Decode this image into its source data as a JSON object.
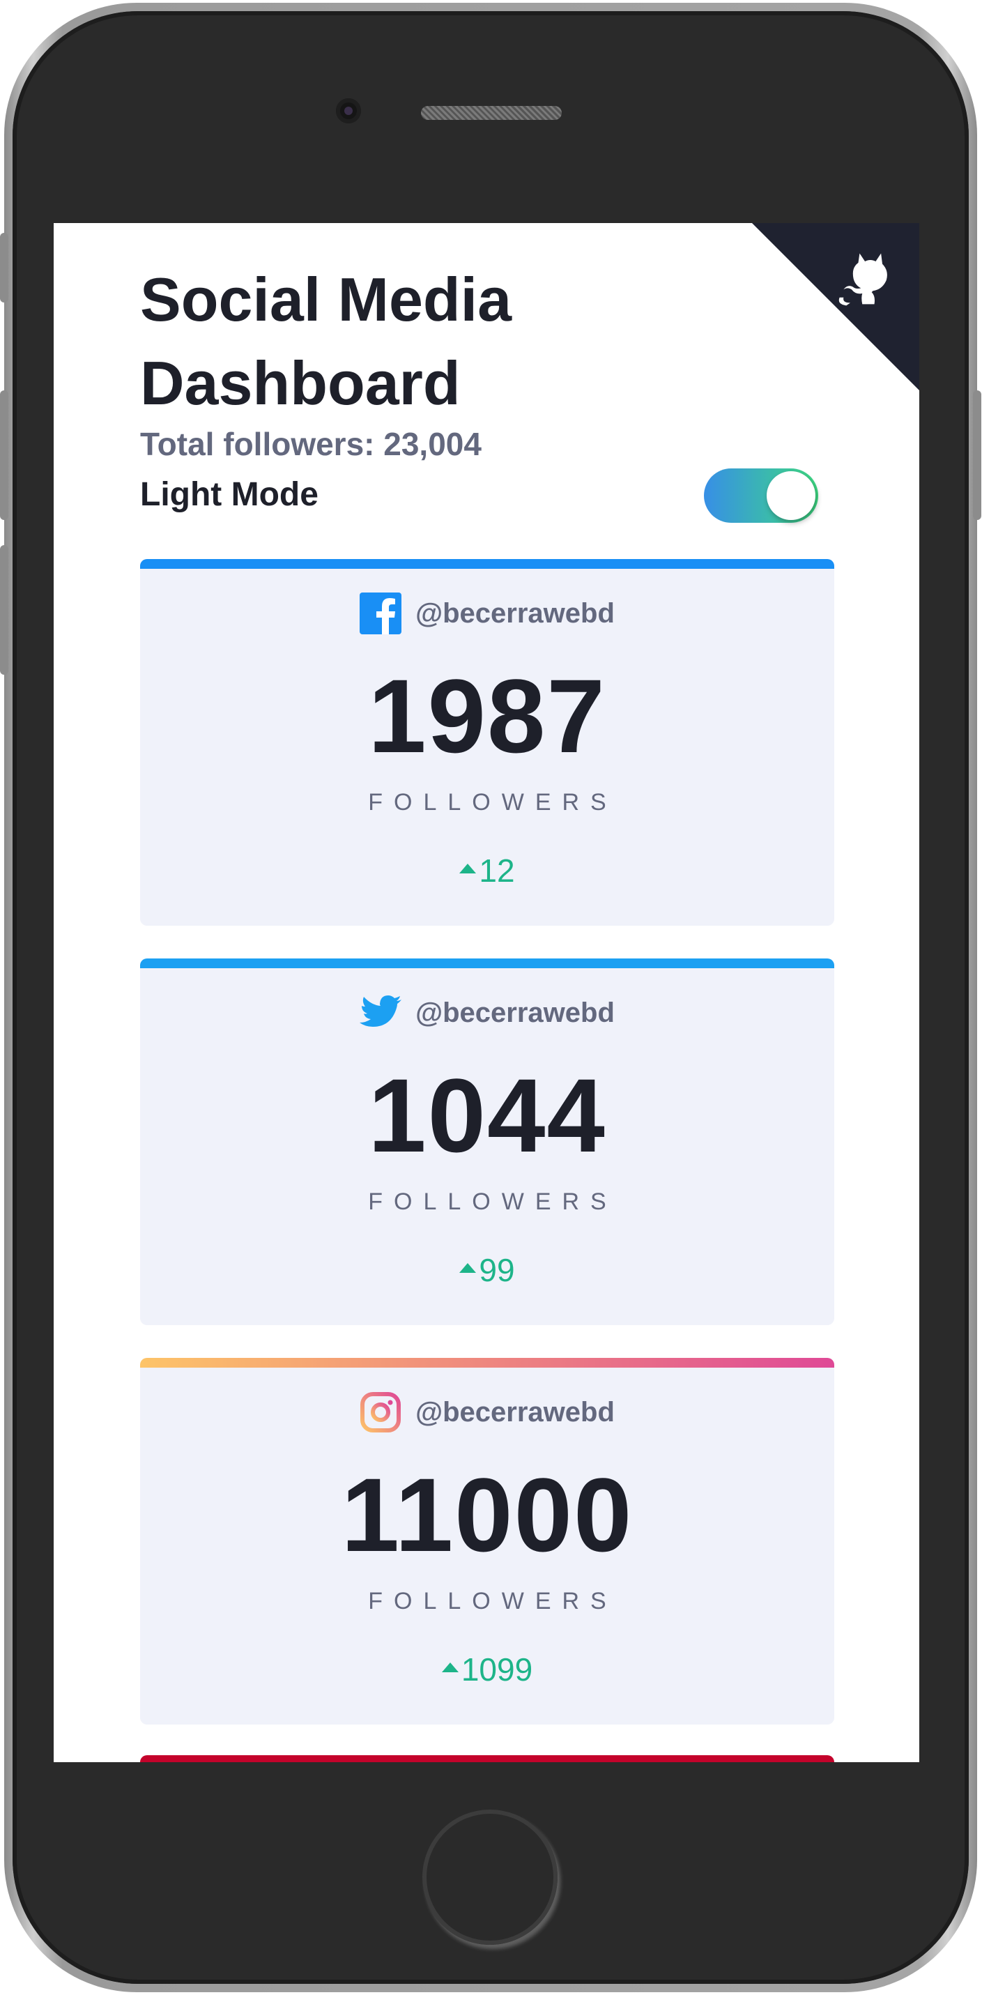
{
  "header": {
    "title": "Social Media Dashboard",
    "total_followers": "Total followers: 23,004",
    "mode_label": "Light Mode",
    "toggle_on": true
  },
  "colors": {
    "facebook": "#198ff5",
    "twitter": "#1ca0f2",
    "instagram_start": "#fdc468",
    "instagram_end": "#df4996",
    "youtube": "#c4032b",
    "positive": "#1db489",
    "card_bg": "#f0f2fa",
    "corner_bg": "#1f2230"
  },
  "cards": [
    {
      "network": "facebook",
      "icon": "facebook-icon",
      "handle": "@becerrawebd",
      "count": "1987",
      "label": "FOLLOWERS",
      "delta": "12"
    },
    {
      "network": "twitter",
      "icon": "twitter-icon",
      "handle": "@becerrawebd",
      "count": "1044",
      "label": "FOLLOWERS",
      "delta": "99"
    },
    {
      "network": "instagram",
      "icon": "instagram-icon",
      "handle": "@becerrawebd",
      "count": "11000",
      "label": "FOLLOWERS",
      "delta": "1099"
    }
  ],
  "corner_link_icon": "github-icon"
}
